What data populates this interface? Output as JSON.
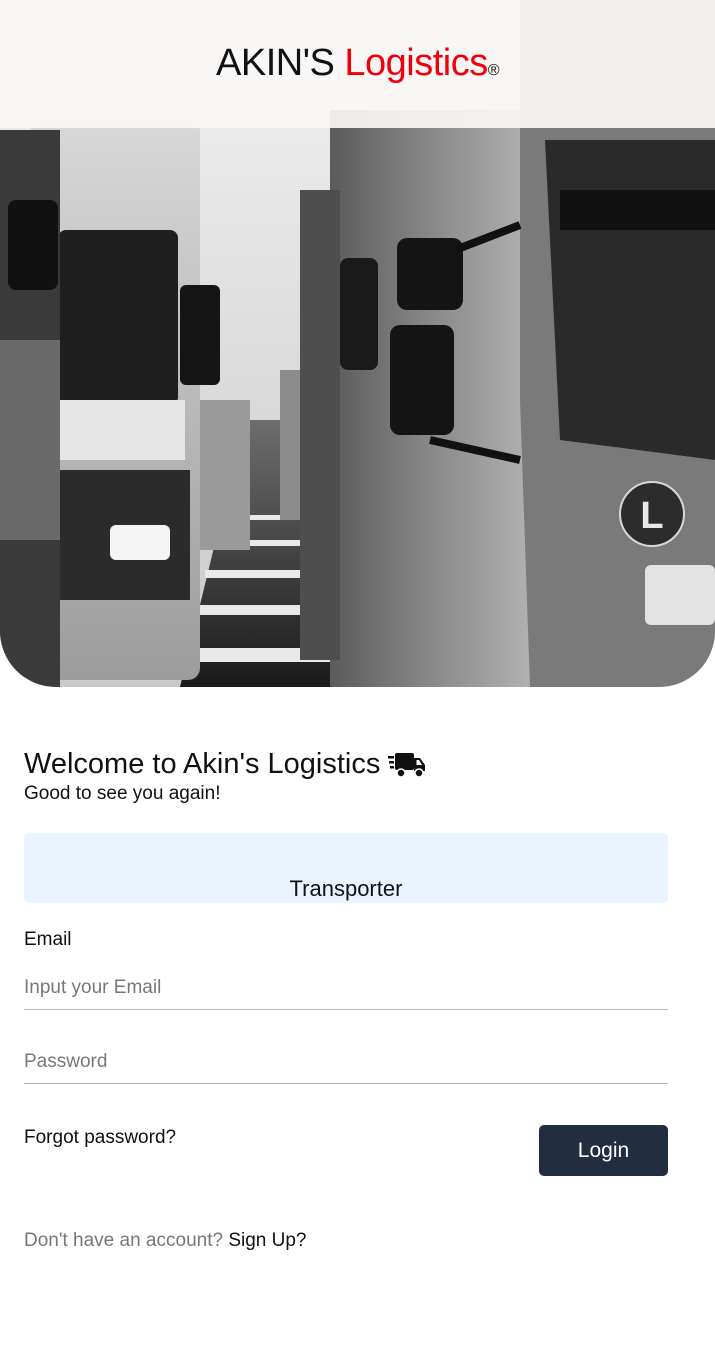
{
  "brand": {
    "name_part1": "AKIN'S ",
    "name_part2": "Logistics",
    "registered_mark": "®",
    "accent_color": "#f0000a"
  },
  "hero": {
    "image_subject": "black-and-white photo of trucks queued on a highway",
    "truck_emblem_letter": "L"
  },
  "welcome": {
    "title": "Welcome to Akin's Logistics",
    "title_icon": "shipping-fast-truck-icon",
    "subtitle": "Good to see you again!"
  },
  "role_selector": {
    "selected": "Transporter",
    "background_color": "#eaf4ff"
  },
  "form": {
    "email_label": "Email",
    "email_placeholder": "Input your Email",
    "email_value": "",
    "password_placeholder": "Password",
    "password_value": "",
    "forgot_label": "Forgot password?",
    "login_label": "Login",
    "login_color": "#222d3f"
  },
  "signup": {
    "prompt": "Don't have an account?",
    "link": "Sign Up?"
  }
}
